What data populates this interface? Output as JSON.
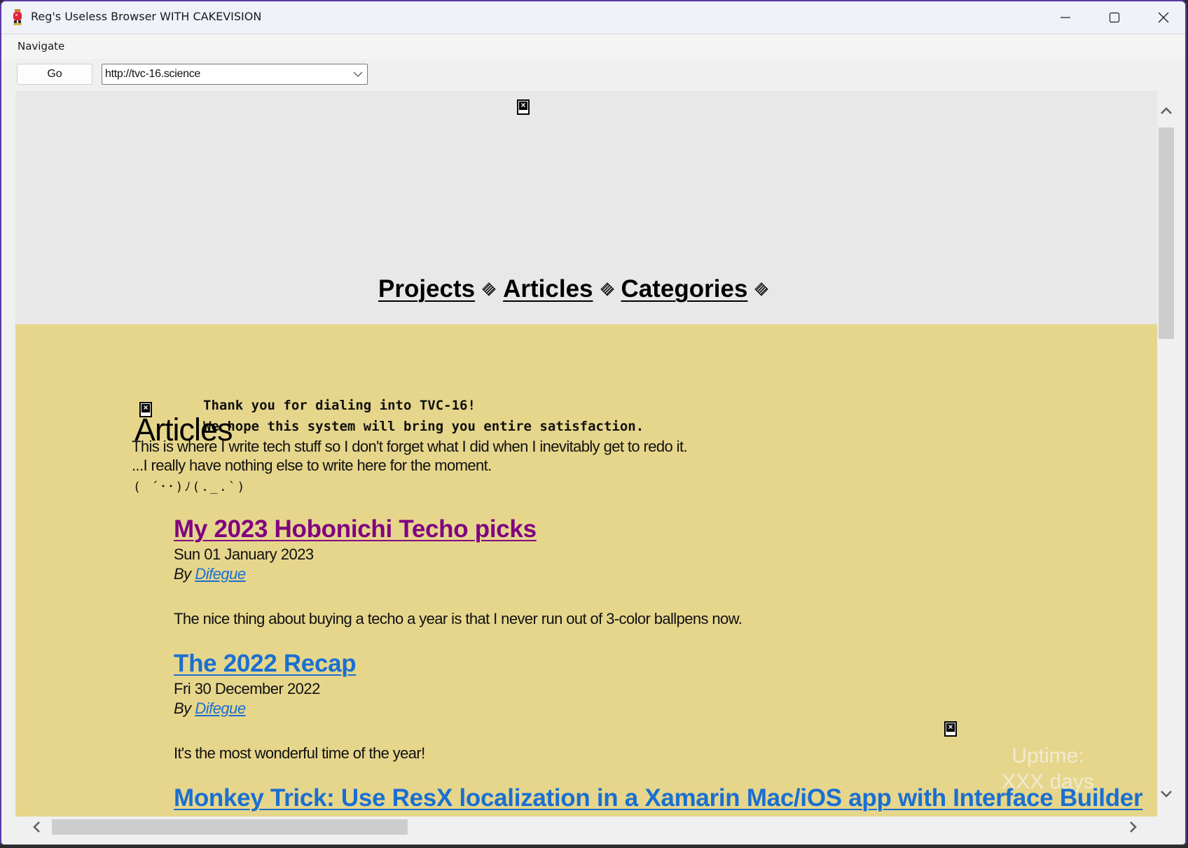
{
  "window": {
    "title": "Reg's Useless Browser WITH CAKEVISION",
    "controls": [
      "minimize",
      "maximize",
      "close"
    ]
  },
  "menubar": {
    "items": [
      {
        "label": "Navigate"
      }
    ]
  },
  "toolbar": {
    "go_label": "Go",
    "url": "http://tvc-16.science"
  },
  "page": {
    "nav": [
      {
        "label": "Projects"
      },
      {
        "label": "Articles"
      },
      {
        "label": "Categories"
      }
    ],
    "welcome": [
      "Thank you for dialing into TVC-16!",
      "We hope this system will bring you entire satisfaction."
    ],
    "heading": "Articles",
    "intro": [
      "This is where I write tech stuff so I don't forget what I did when I inevitably get to redo it.",
      "...I really have nothing else to write here for the moment."
    ],
    "kaomoji": "( ´･･)ﾉ(._.`)",
    "articles": [
      {
        "title": "My 2023 Hobonichi Techo picks",
        "visited": true,
        "date": "Sun 01 January 2023",
        "by_prefix": "By",
        "author": "Difegue",
        "summary": "The nice thing about buying a techo a year is that I never run out of 3-color ballpens now."
      },
      {
        "title": "The 2022 Recap",
        "visited": false,
        "date": "Fri 30 December 2022",
        "by_prefix": "By",
        "author": "Difegue",
        "summary": "It's the most wonderful time of the year!"
      },
      {
        "title": "Monkey Trick: Use ResX localization in a Xamarin Mac/iOS app with Interface Builder",
        "visited": false
      }
    ],
    "uptime": {
      "label": "Uptime:",
      "value": "XXX days"
    }
  },
  "colors": {
    "header_bg": "#e8e8e8",
    "content_bg": "#e6d68c",
    "link_visited": "#800080",
    "link": "#1a6fd1",
    "window_border": "#5b3aa6"
  },
  "scrollbars": {
    "vertical_position": 0,
    "horizontal_position": 0
  }
}
